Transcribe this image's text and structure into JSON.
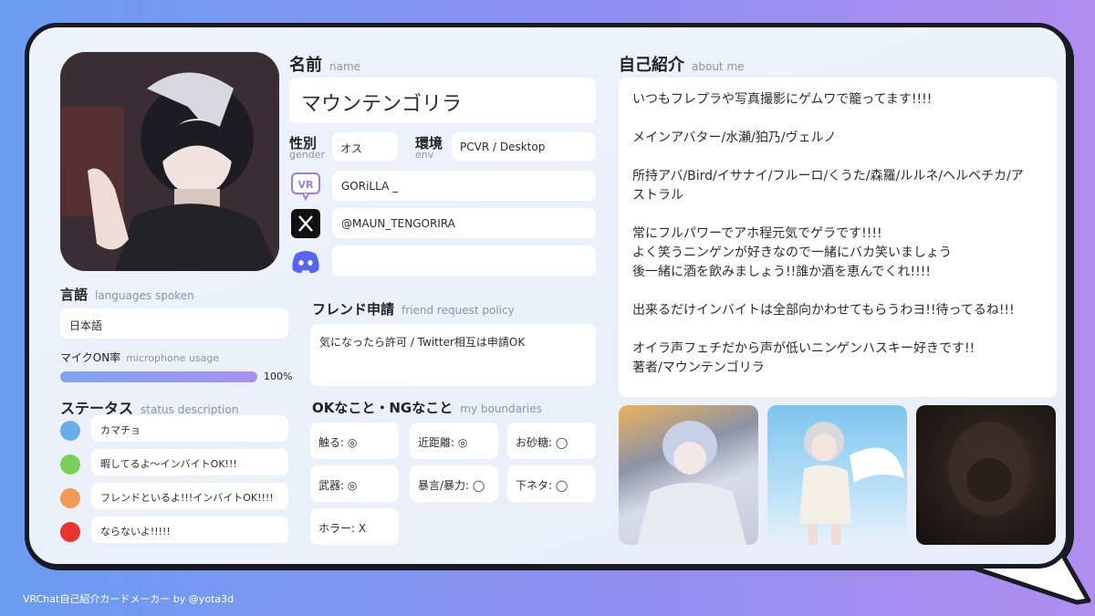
{
  "profile": {
    "name_label": "名前",
    "name_label_en": "name",
    "name": "マウンテンゴリラ",
    "gender_label": "性別",
    "gender_label_en": "gender",
    "gender": "オス",
    "env_label": "環境",
    "env_label_en": "env",
    "env": "PCVR / Desktop",
    "vrchat_id": "GORiLLA _",
    "x_handle": "@MAUN_TENGORIRA",
    "discord": ""
  },
  "languages": {
    "label": "言語",
    "label_en": "languages spoken",
    "value": "日本語"
  },
  "mic": {
    "label": "マイクON率",
    "label_en": "microphone usage",
    "percent": 100,
    "percent_text": "100%"
  },
  "status": {
    "label": "ステータス",
    "label_en": "status description",
    "items": [
      {
        "color": "#6aaee8",
        "text": "カマチョ"
      },
      {
        "color": "#7ccf5a",
        "text": "暇してるよ〜インバイトOK!!!"
      },
      {
        "color": "#f09a55",
        "text": "フレンドといるよ!!!インバイトOK!!!!"
      },
      {
        "color": "#e8352f",
        "text": "ならないよ!!!!!"
      }
    ]
  },
  "friend_policy": {
    "label": "フレンド申請",
    "label_en": "friend request policy",
    "value": "気になったら許可 / Twitter相互は申請OK"
  },
  "boundaries": {
    "label": "OKなこと・NGなこと",
    "label_en": "my boundaries",
    "items": [
      "触る: ◎",
      "近距離: ◎",
      "お砂糖: ◯",
      "武器: ◎",
      "暴言/暴力: ◯",
      "下ネタ: ◯",
      "ホラー: X"
    ]
  },
  "about": {
    "label": "自己紹介",
    "label_en": "about me",
    "text": "いつもフレプラや写真撮影にゲムワで籠ってます!!!!\n\nメインアバター/水瀬/狛乃/ヴェルノ\n\n所持アバ/Bird/イサナイ/フルーロ/くうた/森羅/ルルネ/ヘルベチカ/アストラル\n\n常にフルパワーでアホ程元気でゲラです!!!!\nよく笑うニンゲンが好きなので一緒にバカ笑いましょう\n後一緒に酒を飲みましょう!!誰か酒を恵んでくれ!!!!\n\n出来るだけインバイトは全部向かわせてもらうわヨ!!待ってるね!!!\n\nオイラ声フェチだから声が低いニンゲンハスキー好きです!!\n著者/マウンテンゴリラ"
  },
  "icons": {
    "vrchat": "vrchat-icon",
    "x": "x-logo-icon",
    "discord": "discord-icon"
  },
  "footer": "VRChat自己紹介カードメーカー by @yota3d"
}
